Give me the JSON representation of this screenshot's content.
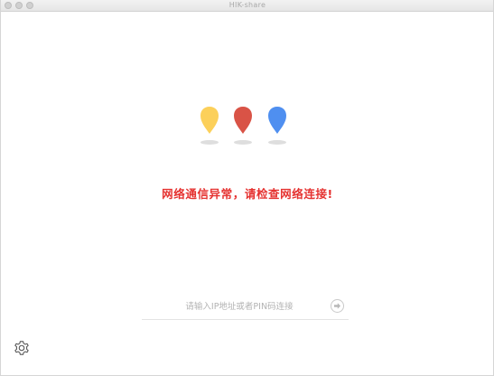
{
  "window": {
    "title": "HIK-share"
  },
  "status": {
    "error_message": "网络通信异常，请检查网络连接!"
  },
  "connect": {
    "placeholder": "请输入IP地址或者PIN码连接",
    "value": ""
  },
  "icons": {
    "pins": [
      {
        "name": "yellow-pin-icon",
        "color": "#fcd05a"
      },
      {
        "name": "red-pin-icon",
        "color": "#d95346"
      },
      {
        "name": "blue-pin-icon",
        "color": "#4f8ff0"
      }
    ],
    "go": "arrow-right-icon",
    "settings": "gear-icon"
  },
  "colors": {
    "error": "#e5312f",
    "shadow": "#dedede"
  }
}
